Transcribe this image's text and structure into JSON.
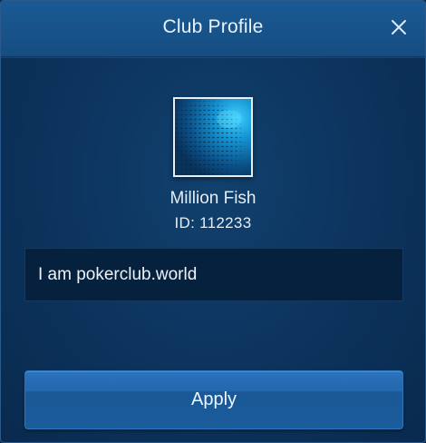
{
  "dialog": {
    "title": "Club Profile",
    "close_icon": "close-icon"
  },
  "club": {
    "avatar_icon": "fish-school-image",
    "name": "Million Fish",
    "id_text": "ID: 112233",
    "description": "I am pokerclub.world"
  },
  "actions": {
    "apply_label": "Apply"
  },
  "colors": {
    "background": "#0d3560",
    "header": "#1a5a93",
    "input_background": "#06213e",
    "button": "#2367ac",
    "text": "#e6edf5"
  }
}
